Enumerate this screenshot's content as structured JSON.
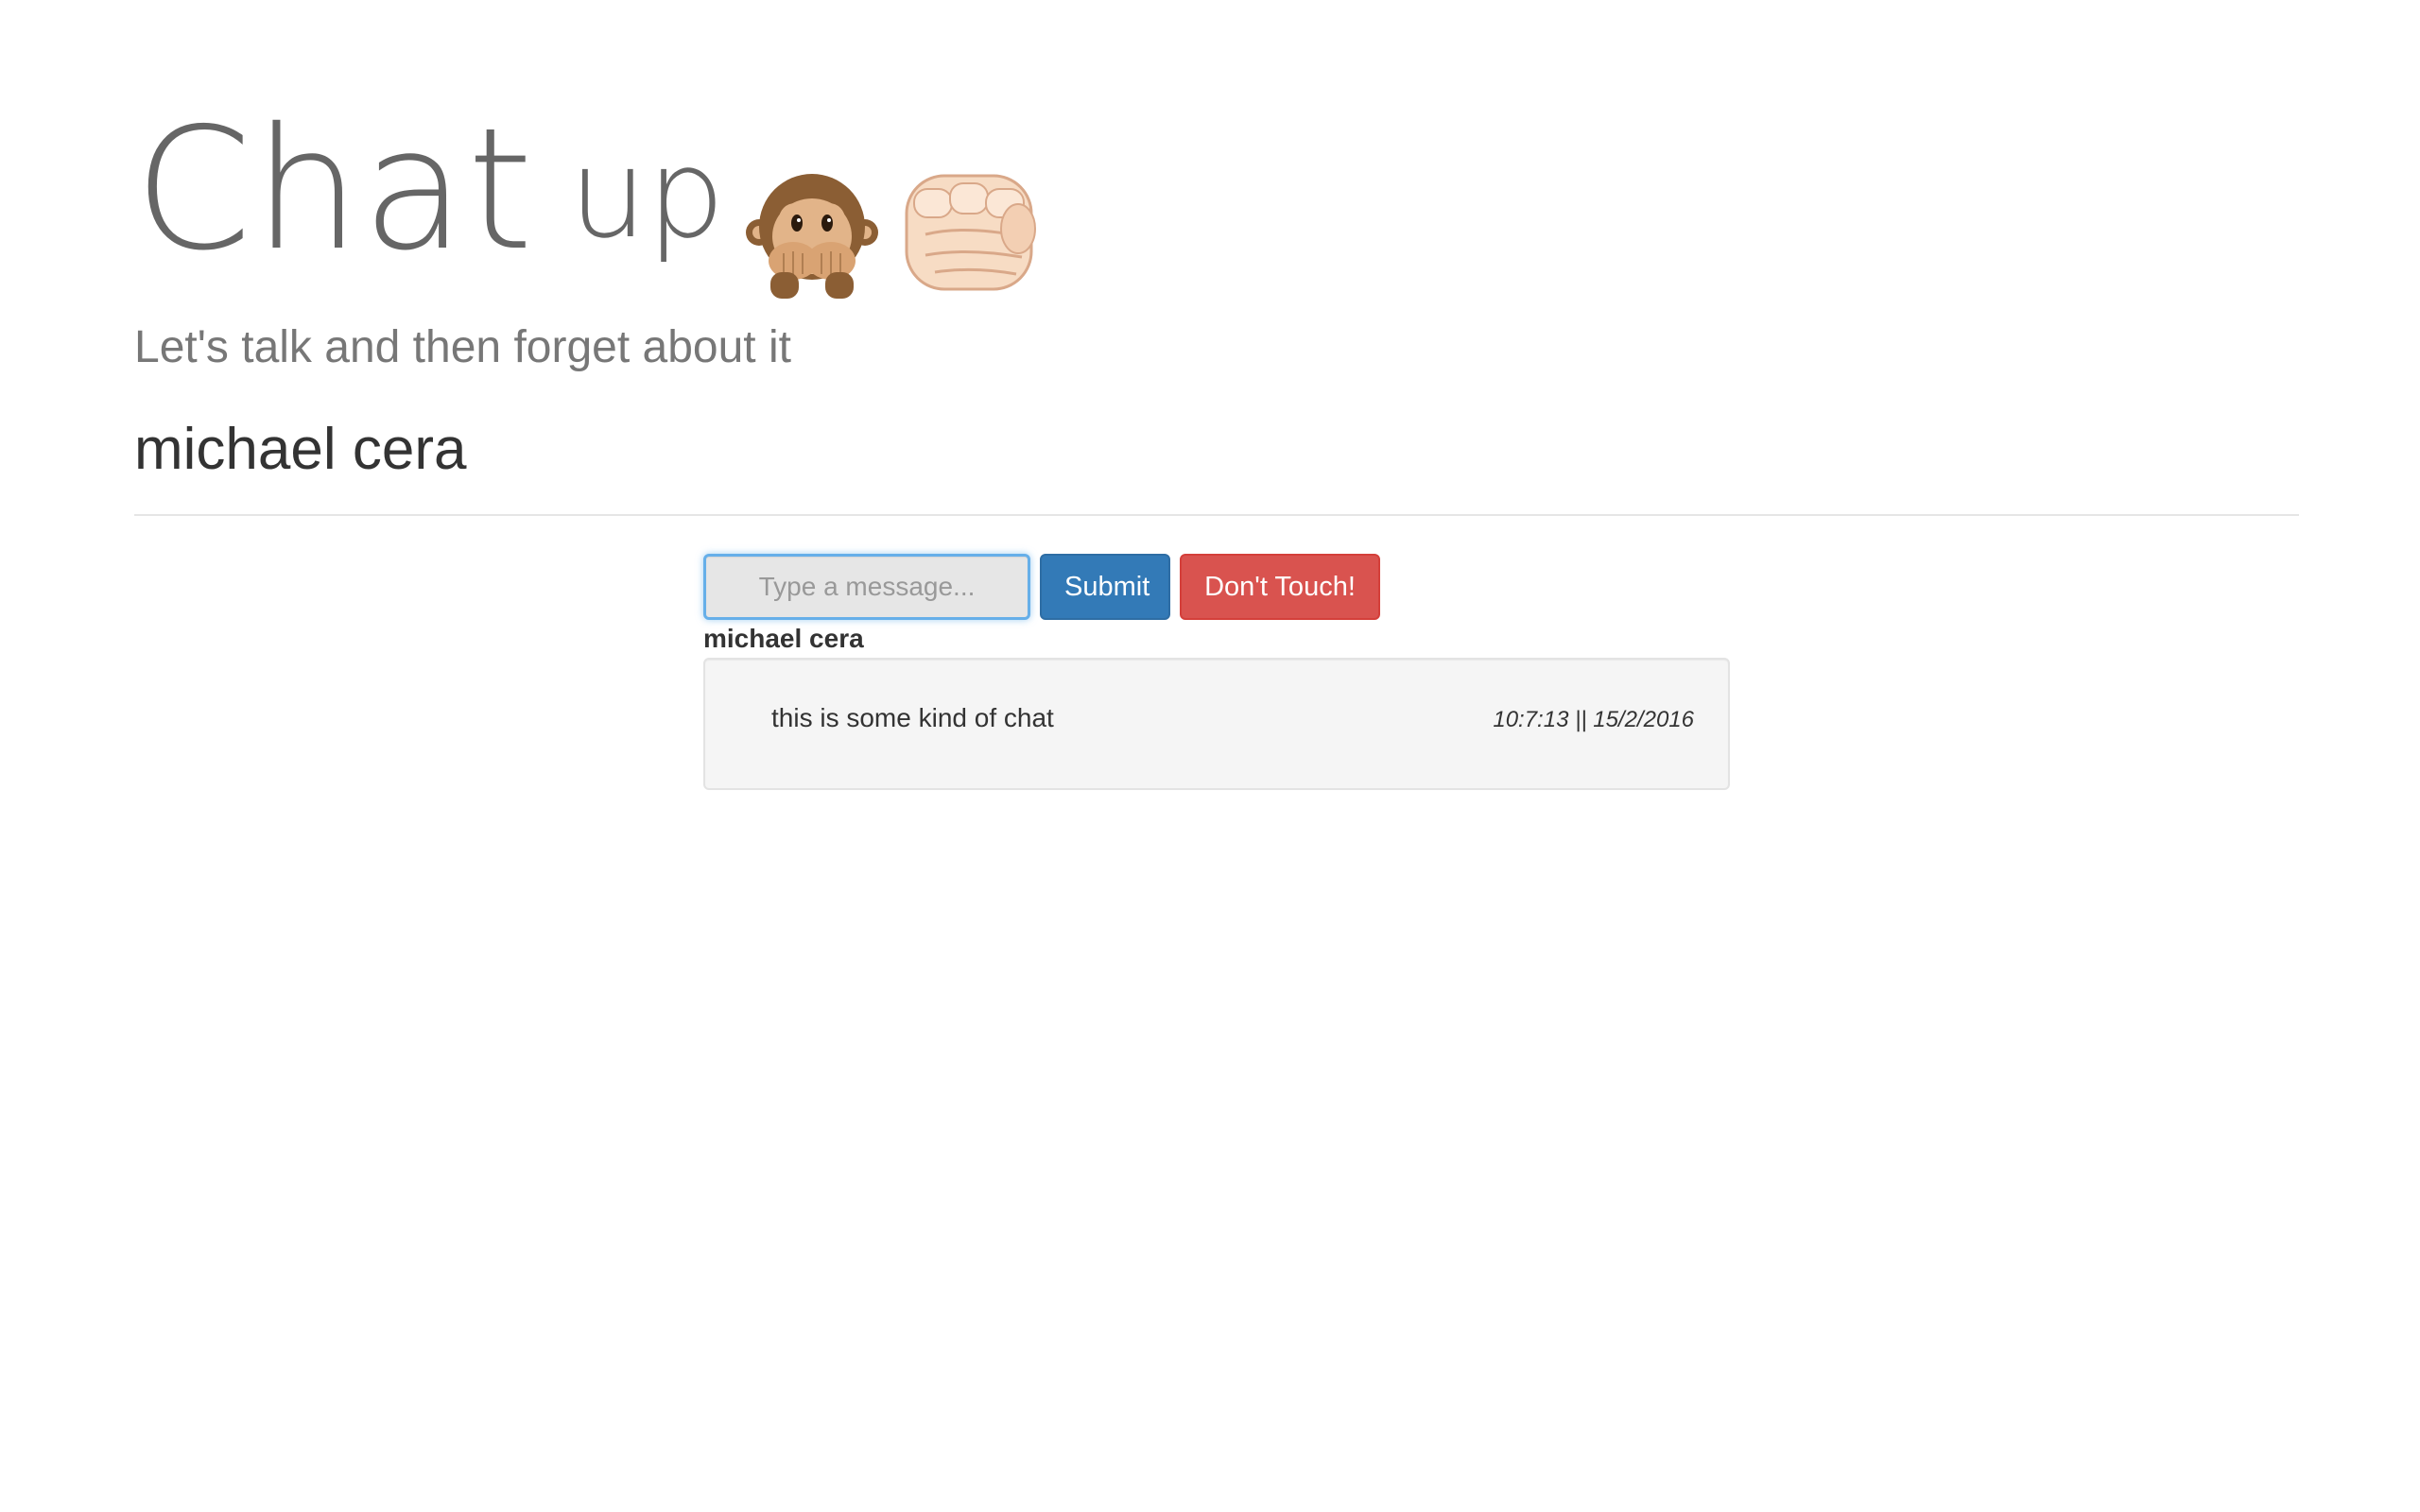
{
  "header": {
    "brand_word": "Chat",
    "brand_up": "up",
    "emoji_1": "speak-no-evil-monkey-icon",
    "emoji_2": "fist-bump-icon",
    "subtitle": "Let's talk and then forget about it",
    "username": "michael cera"
  },
  "composer": {
    "input_value": "",
    "input_placeholder": "Type a message...",
    "submit_label": "Submit",
    "danger_label": "Don't Touch!"
  },
  "messages": [
    {
      "author": "michael cera",
      "text": "this is some kind of chat",
      "timestamp": "10:7:13 || 15/2/2016"
    }
  ],
  "colors": {
    "primary": "#337ab7",
    "danger": "#d9534f",
    "focus": "#66afe9",
    "well": "#f5f5f5"
  }
}
